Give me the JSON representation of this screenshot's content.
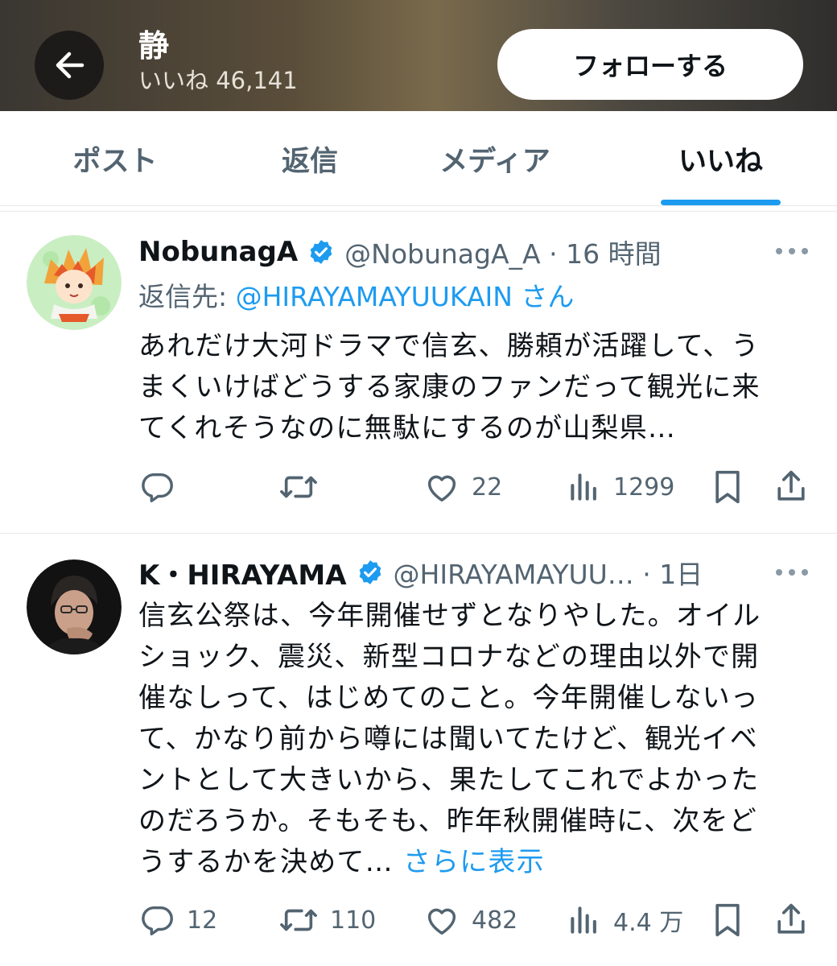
{
  "header": {
    "title": "静",
    "likes_label": "いいね 46,141",
    "follow_label": "フォローする"
  },
  "tabs": [
    {
      "label": "ポスト"
    },
    {
      "label": "返信"
    },
    {
      "label": "メディア"
    },
    {
      "label": "いいね",
      "active": true
    }
  ],
  "posts": [
    {
      "name": "NobunagA",
      "handle": "@NobunagA_A · 16 時間",
      "reply_prefix": "返信先: ",
      "reply_mention": "@HIRAYAMAYUUKAIN さん",
      "text": "あれだけ大河ドラマで信玄、勝頼が活躍して、う\nまくいけばどうする家康のファンだって観光に来\nてくれそうなのに無駄にするのが山梨県…",
      "show_more": "",
      "replies": "",
      "reposts": "",
      "likes": "22",
      "views": "1299"
    },
    {
      "name": "K・HIRAYAMA",
      "handle": "@HIRAYAMAYUU… · 1日",
      "text": "信玄公祭は、今年開催せずとなりやした。オイル\nショック、震災、新型コロナなどの理由以外で開\n催なしって、はじめてのこと。今年開催しないっ\nて、かなり前から噂には聞いてたけど、観光イベ\nントとして大きいから、果たしてこれでよかった\nのだろうか。そもそも、昨年秋開催時に、次をど\nうするかを決めて… ",
      "show_more": "さらに表示",
      "replies": "12",
      "reposts": "110",
      "likes": "482",
      "views": "4.4 万"
    }
  ],
  "colors": {
    "accent": "#1d9bf0",
    "text_primary": "#0f1419",
    "text_secondary": "#536471"
  }
}
